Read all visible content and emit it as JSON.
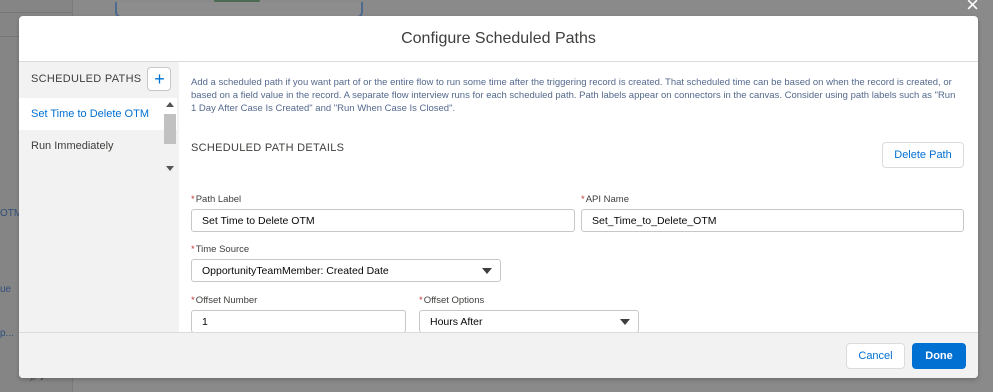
{
  "background": {
    "left_labels": [
      "OTM",
      "ue",
      "p..."
    ]
  },
  "modal": {
    "title": "Configure Scheduled Paths",
    "close_icon": "close-icon"
  },
  "sidebar": {
    "title": "SCHEDULED PATHS",
    "add_button_icon": "plus-icon",
    "add_glyph": "+",
    "items": [
      {
        "label": "Set Time to Delete OTM",
        "selected": true
      },
      {
        "label": "Run Immediately",
        "selected": false
      }
    ]
  },
  "content": {
    "intro": "Add a scheduled path if you want part of or the entire flow to run some time after the triggering record is created. That scheduled time can be based on when the record is created, or based on a field value in the record. A separate flow interview runs for each scheduled path. Path labels appear on connectors in the canvas. Consider using path labels such as \"Run 1 Day After Case Is Created\" and \"Run When Case Is Closed\".",
    "section_title": "SCHEDULED PATH DETAILS",
    "delete_button": "Delete Path",
    "fields": {
      "path_label": {
        "label": "Path Label",
        "value": "Set Time to Delete OTM"
      },
      "api_name": {
        "label": "API Name",
        "value": "Set_Time_to_Delete_OTM"
      },
      "time_source": {
        "label": "Time Source",
        "value": "OpportunityTeamMember: Created Date"
      },
      "offset_number": {
        "label": "Offset Number",
        "value": "1"
      },
      "offset_options": {
        "label": "Offset Options",
        "value": "Hours After"
      }
    },
    "required_mark": "*"
  },
  "footer": {
    "cancel": "Cancel",
    "done": "Done"
  },
  "colors": {
    "brand": "#0070d2",
    "required": "#c23934"
  }
}
